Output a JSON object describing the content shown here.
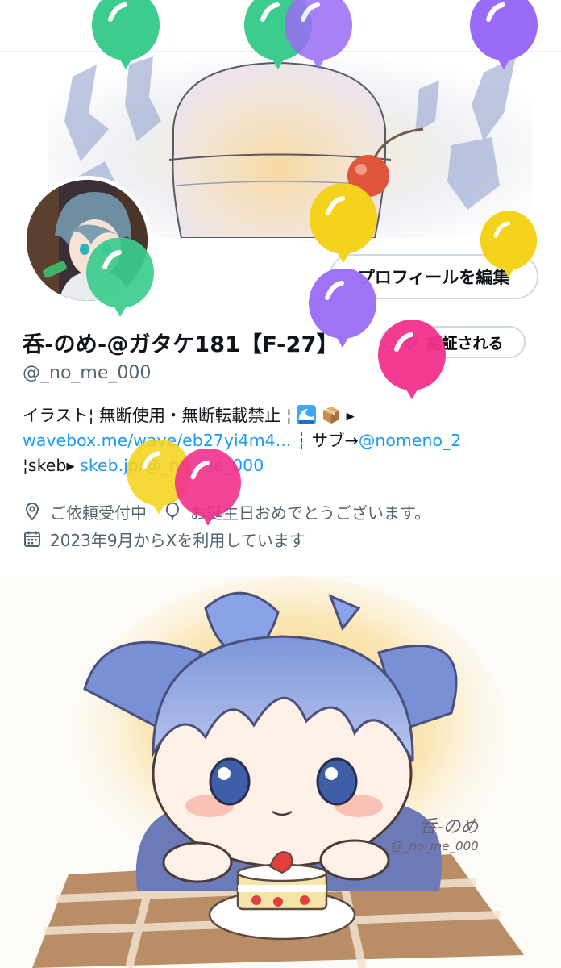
{
  "profile": {
    "display_name": "呑-のめ-@ガタケ181【F-27】",
    "handle": "@_no_me_000",
    "edit_profile_label": "プロフィールを編集",
    "get_verified_label": "認証される"
  },
  "bio": {
    "line1_text": "イラスト¦ 無断使用・無断転載禁止 ¦ ",
    "line1_arrow": "▸",
    "line2_link": "wavebox.me/wave/eb27yi4m4...",
    "line2_mid": " ┆ サブ→",
    "line2_mention": "@nomeno_2",
    "line3_prefix": "¦skeb▸ ",
    "line3_link": "skeb.jp/@_no_me_000"
  },
  "meta": {
    "location": "ご依頼受付中",
    "birthday": "お誕生日おめでとうございます。",
    "joined": "2023年9月からXを利用しています"
  },
  "icons": [
    "location-pin-icon",
    "balloon-icon",
    "calendar-icon",
    "verified-badge-icon",
    "wave-emoji-icon",
    "package-emoji-icon"
  ],
  "colors": {
    "link": "#1d9bf0",
    "secondary_text": "#536471",
    "balloon_green": "#3ccc8e",
    "balloon_purple": "#9a6cf5",
    "balloon_yellow": "#f5d31c",
    "balloon_pink": "#f2318c"
  },
  "balloons": [
    {
      "color": "green"
    },
    {
      "color": "green"
    },
    {
      "color": "purple"
    },
    {
      "color": "purple"
    },
    {
      "color": "yellow"
    },
    {
      "color": "yellow"
    },
    {
      "color": "green"
    },
    {
      "color": "purple"
    },
    {
      "color": "pink"
    },
    {
      "color": "yellow"
    },
    {
      "color": "pink"
    }
  ],
  "artwork": {
    "signature": "呑-のめ",
    "signature_handle": "@_no_me_000"
  }
}
